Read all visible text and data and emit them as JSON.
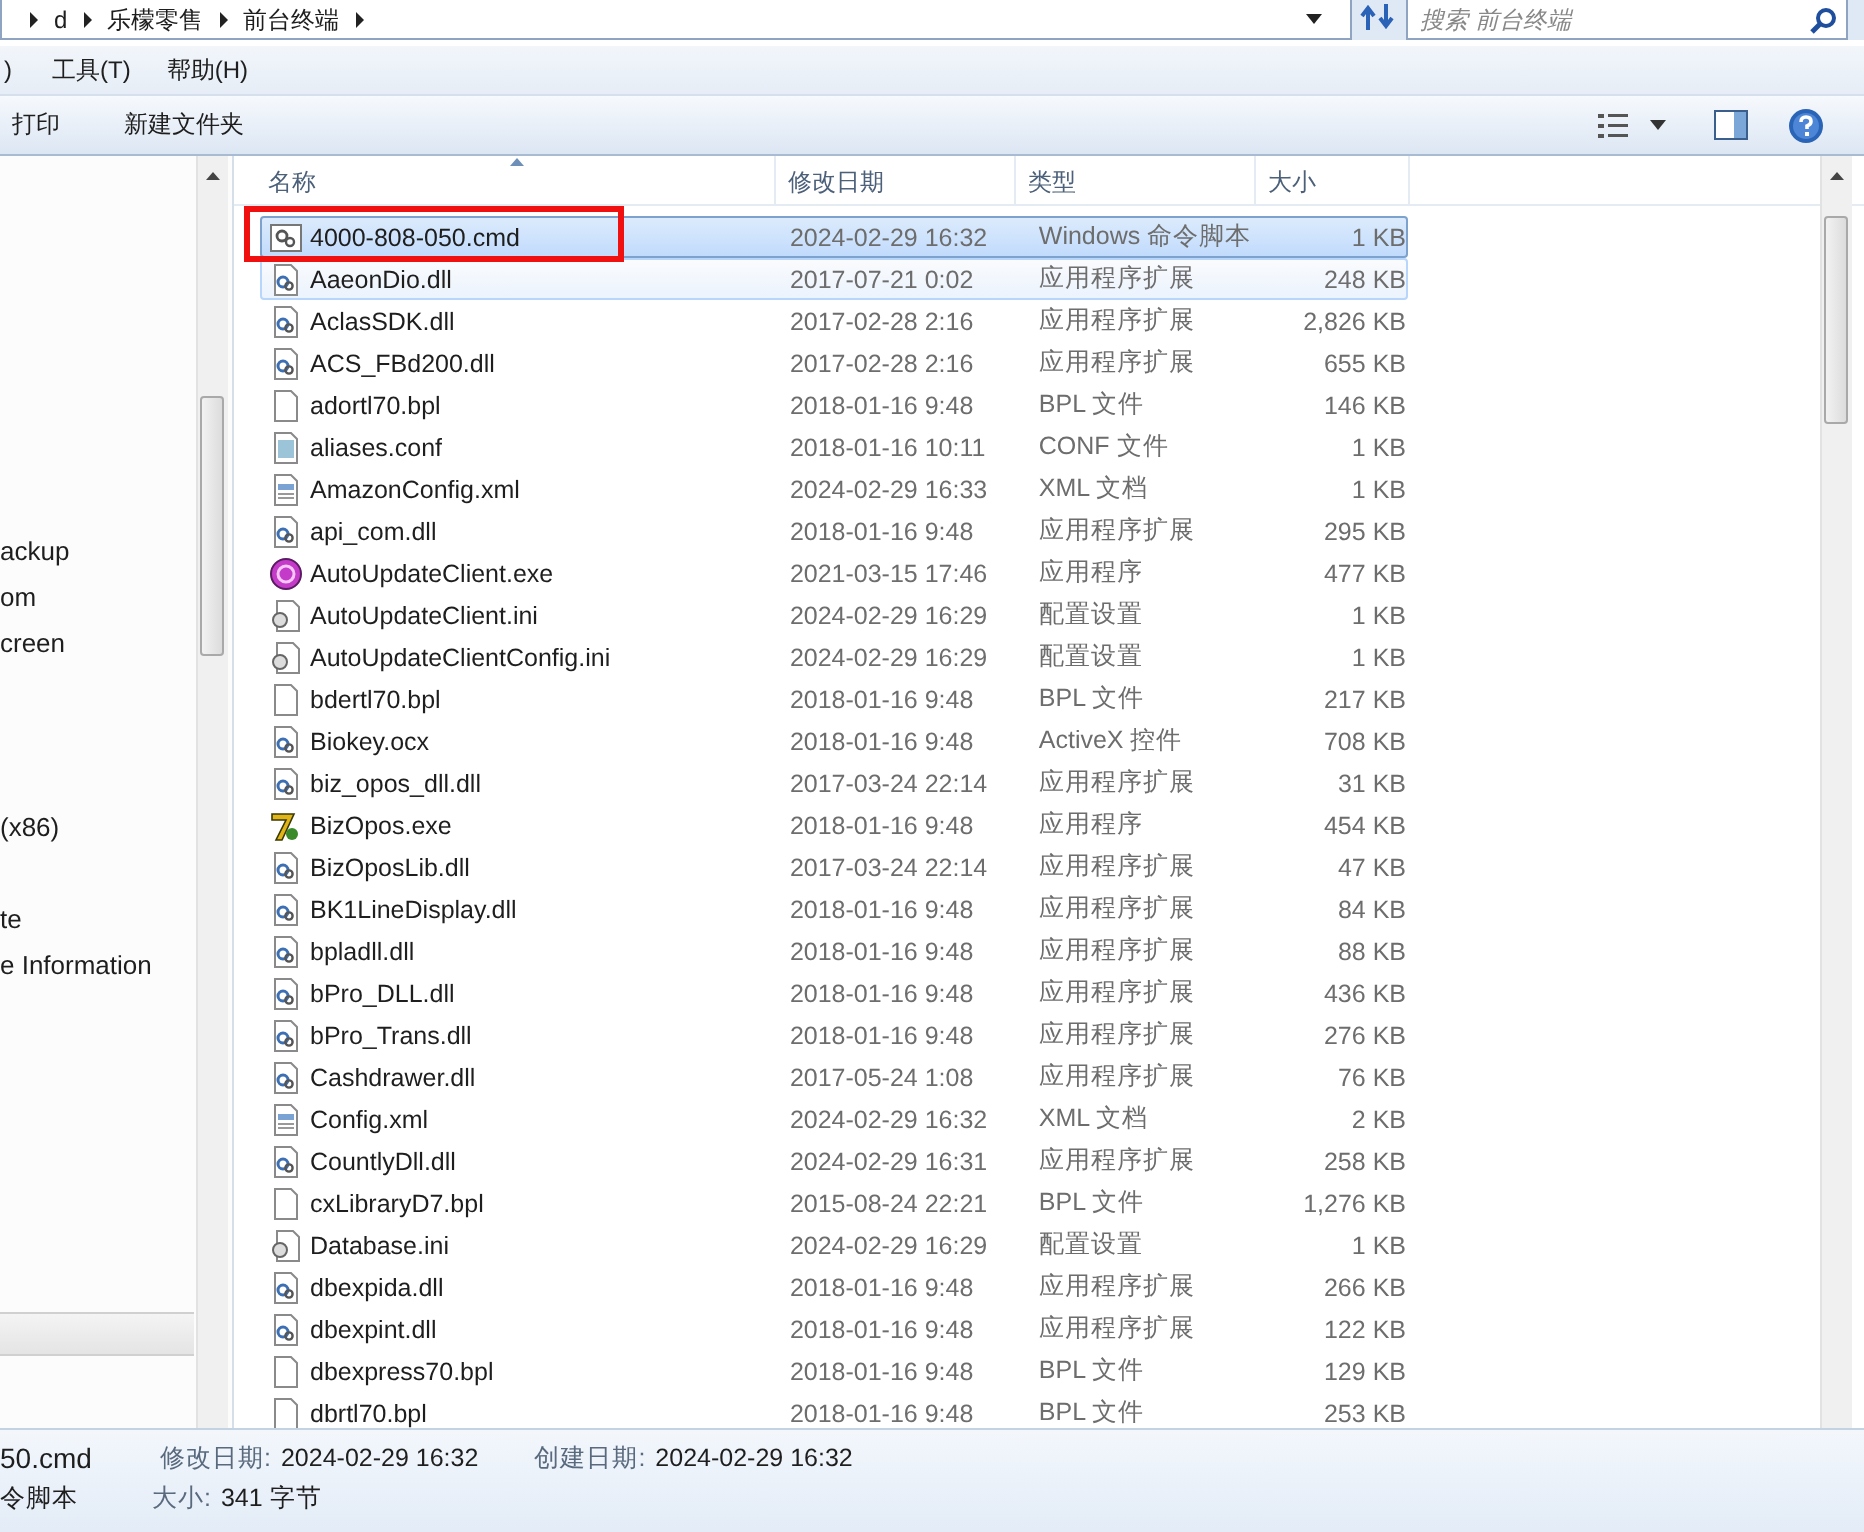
{
  "address_bar": {
    "crumbs": [
      "d",
      "乐檬零售",
      "前台终端"
    ]
  },
  "search": {
    "placeholder": "搜索 前台终端"
  },
  "menu": [
    ")",
    "工具(T)",
    "帮助(H)"
  ],
  "toolbar": [
    "打印",
    "新建文件夹"
  ],
  "nav": {
    "items": [
      "ackup",
      "om",
      "creen",
      "(x86)",
      "te",
      "e Information"
    ]
  },
  "table": {
    "columns": [
      "名称",
      "修改日期",
      "类型",
      "大小"
    ],
    "rows": [
      {
        "name": "4000-808-050.cmd",
        "date": "2024-02-29 16:32",
        "type": "Windows 命令脚本",
        "size": "1 KB",
        "kind": "cmd",
        "selected": true,
        "hovered": false
      },
      {
        "name": "AaeonDio.dll",
        "date": "2017-07-21 0:02",
        "type": "应用程序扩展",
        "size": "248 KB",
        "kind": "dll",
        "selected": false,
        "hovered": true
      },
      {
        "name": "AclasSDK.dll",
        "date": "2017-02-28 2:16",
        "type": "应用程序扩展",
        "size": "2,826 KB",
        "kind": "dll",
        "selected": false,
        "hovered": false
      },
      {
        "name": "ACS_FBd200.dll",
        "date": "2017-02-28 2:16",
        "type": "应用程序扩展",
        "size": "655 KB",
        "kind": "dll",
        "selected": false,
        "hovered": false
      },
      {
        "name": "adortl70.bpl",
        "date": "2018-01-16 9:48",
        "type": "BPL 文件",
        "size": "146 KB",
        "kind": "blank",
        "selected": false,
        "hovered": false
      },
      {
        "name": "aliases.conf",
        "date": "2018-01-16 10:11",
        "type": "CONF 文件",
        "size": "1 KB",
        "kind": "conf",
        "selected": false,
        "hovered": false
      },
      {
        "name": "AmazonConfig.xml",
        "date": "2024-02-29 16:33",
        "type": "XML 文档",
        "size": "1 KB",
        "kind": "xml",
        "selected": false,
        "hovered": false
      },
      {
        "name": "api_com.dll",
        "date": "2018-01-16 9:48",
        "type": "应用程序扩展",
        "size": "295 KB",
        "kind": "dll",
        "selected": false,
        "hovered": false
      },
      {
        "name": "AutoUpdateClient.exe",
        "date": "2021-03-15 17:46",
        "type": "应用程序",
        "size": "477 KB",
        "kind": "disc",
        "selected": false,
        "hovered": false
      },
      {
        "name": "AutoUpdateClient.ini",
        "date": "2024-02-29 16:29",
        "type": "配置设置",
        "size": "1 KB",
        "kind": "ini",
        "selected": false,
        "hovered": false
      },
      {
        "name": "AutoUpdateClientConfig.ini",
        "date": "2024-02-29 16:29",
        "type": "配置设置",
        "size": "1 KB",
        "kind": "ini",
        "selected": false,
        "hovered": false
      },
      {
        "name": "bdertl70.bpl",
        "date": "2018-01-16 9:48",
        "type": "BPL 文件",
        "size": "217 KB",
        "kind": "blank",
        "selected": false,
        "hovered": false
      },
      {
        "name": "Biokey.ocx",
        "date": "2018-01-16 9:48",
        "type": "ActiveX 控件",
        "size": "708 KB",
        "kind": "dll",
        "selected": false,
        "hovered": false
      },
      {
        "name": "biz_opos_dll.dll",
        "date": "2017-03-24 22:14",
        "type": "应用程序扩展",
        "size": "31 KB",
        "kind": "dll",
        "selected": false,
        "hovered": false
      },
      {
        "name": "BizOpos.exe",
        "date": "2018-01-16 9:48",
        "type": "应用程序",
        "size": "454 KB",
        "kind": "seven",
        "selected": false,
        "hovered": false
      },
      {
        "name": "BizOposLib.dll",
        "date": "2017-03-24 22:14",
        "type": "应用程序扩展",
        "size": "47 KB",
        "kind": "dll",
        "selected": false,
        "hovered": false
      },
      {
        "name": "BK1LineDisplay.dll",
        "date": "2018-01-16 9:48",
        "type": "应用程序扩展",
        "size": "84 KB",
        "kind": "dll",
        "selected": false,
        "hovered": false
      },
      {
        "name": "bpladll.dll",
        "date": "2018-01-16 9:48",
        "type": "应用程序扩展",
        "size": "88 KB",
        "kind": "dll",
        "selected": false,
        "hovered": false
      },
      {
        "name": "bPro_DLL.dll",
        "date": "2018-01-16 9:48",
        "type": "应用程序扩展",
        "size": "436 KB",
        "kind": "dll",
        "selected": false,
        "hovered": false
      },
      {
        "name": "bPro_Trans.dll",
        "date": "2018-01-16 9:48",
        "type": "应用程序扩展",
        "size": "276 KB",
        "kind": "dll",
        "selected": false,
        "hovered": false
      },
      {
        "name": "Cashdrawer.dll",
        "date": "2017-05-24 1:08",
        "type": "应用程序扩展",
        "size": "76 KB",
        "kind": "dll",
        "selected": false,
        "hovered": false
      },
      {
        "name": "Config.xml",
        "date": "2024-02-29 16:32",
        "type": "XML 文档",
        "size": "2 KB",
        "kind": "xml",
        "selected": false,
        "hovered": false
      },
      {
        "name": "CountlyDll.dll",
        "date": "2024-02-29 16:31",
        "type": "应用程序扩展",
        "size": "258 KB",
        "kind": "dll",
        "selected": false,
        "hovered": false
      },
      {
        "name": "cxLibraryD7.bpl",
        "date": "2015-08-24 22:21",
        "type": "BPL 文件",
        "size": "1,276 KB",
        "kind": "blank",
        "selected": false,
        "hovered": false
      },
      {
        "name": "Database.ini",
        "date": "2024-02-29 16:29",
        "type": "配置设置",
        "size": "1 KB",
        "kind": "ini",
        "selected": false,
        "hovered": false
      },
      {
        "name": "dbexpida.dll",
        "date": "2018-01-16 9:48",
        "type": "应用程序扩展",
        "size": "266 KB",
        "kind": "dll",
        "selected": false,
        "hovered": false
      },
      {
        "name": "dbexpint.dll",
        "date": "2018-01-16 9:48",
        "type": "应用程序扩展",
        "size": "122 KB",
        "kind": "dll",
        "selected": false,
        "hovered": false
      },
      {
        "name": "dbexpress70.bpl",
        "date": "2018-01-16 9:48",
        "type": "BPL 文件",
        "size": "129 KB",
        "kind": "blank",
        "selected": false,
        "hovered": false
      },
      {
        "name": "dbrtl70.bpl",
        "date": "2018-01-16 9:48",
        "type": "BPL 文件",
        "size": "253 KB",
        "kind": "blank",
        "selected": false,
        "hovered": false
      }
    ]
  },
  "status_bar": {
    "file_name": "50.cmd",
    "file_type": "令脚本",
    "fields": [
      {
        "label": "修改日期:",
        "value": "2024-02-29 16:32"
      },
      {
        "label": "创建日期:",
        "value": "2024-02-29 16:32"
      },
      {
        "label": "大小:",
        "value": "341 字节"
      }
    ]
  }
}
